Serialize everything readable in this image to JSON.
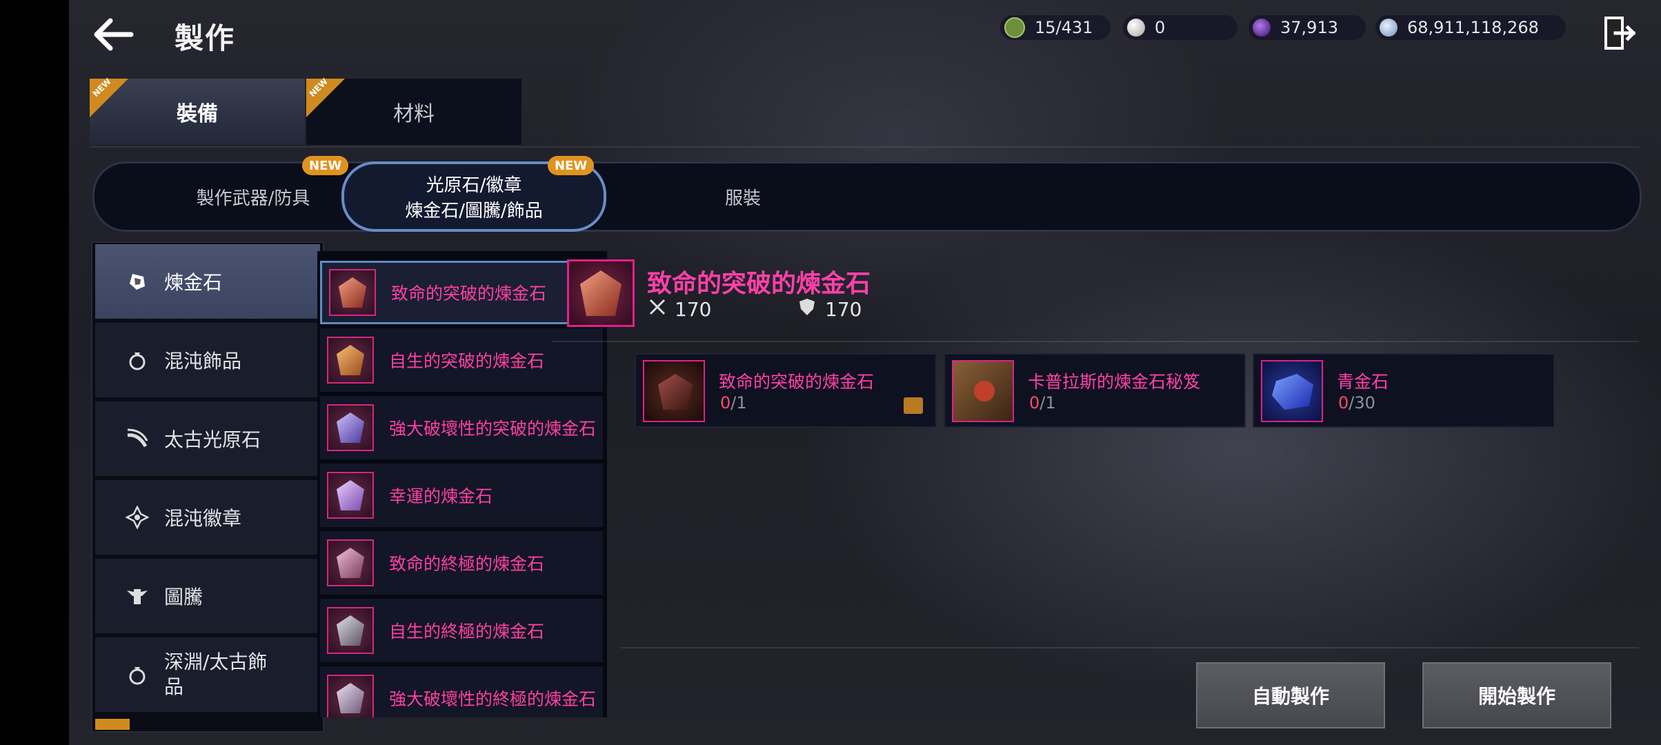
{
  "header": {
    "title": "製作",
    "currencies": [
      {
        "icon": "green-crest-icon",
        "value": "15/431",
        "color": "#6d8f3a"
      },
      {
        "icon": "pearl-icon",
        "value": "0",
        "color": "#cfc6c0"
      },
      {
        "icon": "purple-orb-icon",
        "value": "37,913",
        "color": "#6a2bb0"
      },
      {
        "icon": "silver-coin-icon",
        "value": "68,911,118,268",
        "color": "#9fb8d8"
      }
    ]
  },
  "main_tabs": [
    {
      "label": "裝備",
      "badge": "NEW",
      "active": true
    },
    {
      "label": "材料",
      "badge": "NEW",
      "active": false
    }
  ],
  "sub_tabs": [
    {
      "label_lines": [
        "製作武器/防具"
      ],
      "badge": "NEW",
      "active": false
    },
    {
      "label_lines": [
        "光原石/徽章",
        "煉金石/圖騰/飾品"
      ],
      "badge": "NEW",
      "active": true
    },
    {
      "label_lines": [
        "服裝"
      ],
      "badge": "",
      "active": false
    }
  ],
  "categories": [
    {
      "label": "煉金石",
      "icon": "alchemy-stone-icon",
      "active": true
    },
    {
      "label": "混沌飾品",
      "icon": "ring-icon",
      "active": false
    },
    {
      "label": "太古光原石",
      "icon": "arc-stone-icon",
      "active": false
    },
    {
      "label": "混沌徽章",
      "icon": "emblem-icon",
      "active": false
    },
    {
      "label": "圖騰",
      "icon": "totem-icon",
      "active": false
    },
    {
      "label": "深淵/太古飾品",
      "icon": "ring-icon",
      "active": false
    }
  ],
  "items": [
    {
      "label": "致命的突破的煉金石",
      "gem_color": "#d0654a",
      "selected": true
    },
    {
      "label": "自生的突破的煉金石",
      "gem_color": "#d98a3a",
      "selected": false
    },
    {
      "label": "強大破壞性的突破的煉金石",
      "gem_color": "#9d8cd6",
      "selected": false
    },
    {
      "label": "幸運的煉金石",
      "gem_color": "#b89ae0",
      "selected": false
    },
    {
      "label": "致命的終極的煉金石",
      "gem_color": "#c97a9c",
      "selected": false
    },
    {
      "label": "自生的終極的煉金石",
      "gem_color": "#a7a1a8",
      "selected": false
    },
    {
      "label": "強大破壞性的終極的煉金石",
      "gem_color": "#b5a3c0",
      "selected": false
    }
  ],
  "detail": {
    "name": "致命的突破的煉金石",
    "attack": "170",
    "defense": "170"
  },
  "materials": [
    {
      "name": "致命的突破的煉金石",
      "have": "0",
      "need": "/1",
      "icon": "red-stone-icon",
      "color": "#7a2b22"
    },
    {
      "name": "卡普拉斯的煉金石秘笈",
      "have": "0",
      "need": "/1",
      "icon": "book-icon",
      "color": "#5a3a22"
    },
    {
      "name": "青金石",
      "have": "0",
      "need": "/30",
      "icon": "lapis-icon",
      "color": "#2b4bd0"
    }
  ],
  "buttons": {
    "auto_craft": "自動製作",
    "start_craft": "開始製作"
  }
}
